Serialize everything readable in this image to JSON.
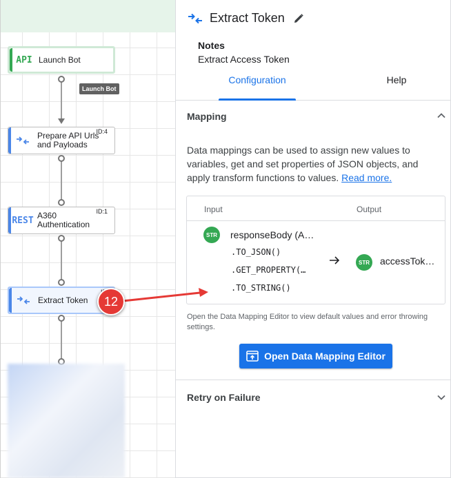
{
  "canvas": {
    "nodes": [
      {
        "icon": "API",
        "label": "Launch Bot",
        "id": ""
      },
      {
        "icon": "transform-arrows-icon",
        "label_line1": "Prepare API Urls",
        "label_line2": "and Payloads",
        "id": "ID:4"
      },
      {
        "icon": "REST",
        "label_line1": "A360",
        "label_line2": "Authentication",
        "id": "ID:1"
      },
      {
        "icon": "transform-arrows-icon",
        "label": "Extract Token",
        "id": "ID"
      }
    ],
    "tooltip": "Launch Bot"
  },
  "callout": {
    "number": "12",
    "color": "#e53935"
  },
  "panel": {
    "title": "Extract Token",
    "notes_label": "Notes",
    "notes_value": "Extract Access Token",
    "tabs": [
      {
        "label": "Configuration",
        "active": true
      },
      {
        "label": "Help",
        "active": false
      }
    ],
    "mapping": {
      "heading": "Mapping",
      "description": "Data mappings can be used to assign new values to variables, get and set properties of JSON objects, and apply transform functions to values.",
      "read_more": "Read more.",
      "table": {
        "input_header": "Input",
        "output_header": "Output",
        "input_badge": "STR",
        "input_name": "responseBody (A…",
        "functions": [
          ".TO_JSON()",
          ".GET_PROPERTY(…",
          ".TO_STRING()"
        ],
        "output_badge": "STR",
        "output_name": "accessTok…"
      },
      "hint": "Open the Data Mapping Editor to view default values and error throwing settings.",
      "button_label": "Open Data Mapping Editor"
    },
    "retry": {
      "heading": "Retry on Failure"
    }
  },
  "colors": {
    "accent": "#1a73e8",
    "success": "#34a853",
    "callout": "#e53935"
  }
}
